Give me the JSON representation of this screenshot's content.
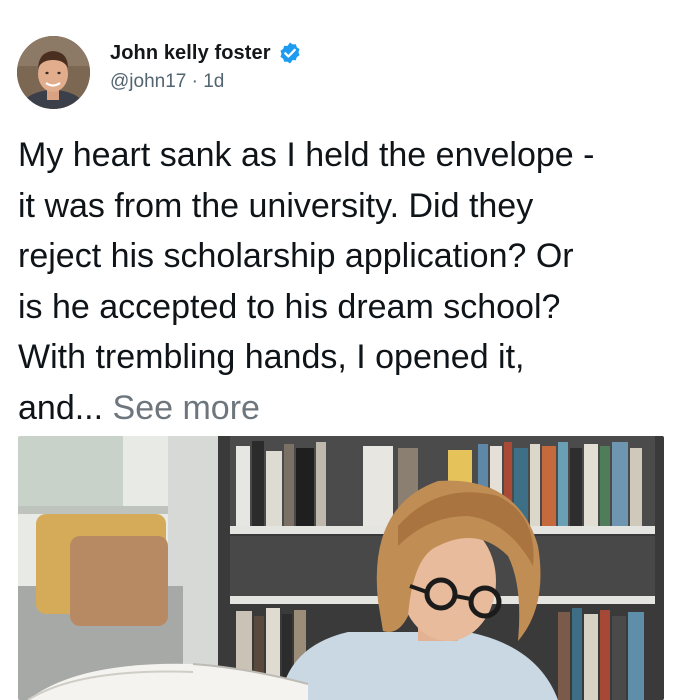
{
  "author": {
    "name": "John kelly foster",
    "handle": "@john17",
    "separator": "·",
    "time": "1d",
    "verified": true,
    "verified_color": "#1d9bf0"
  },
  "tweet": {
    "line1": "My heart sank as I held the envelope -",
    "line2": "it was from the university. Did they",
    "line3": "reject his scholarship application? Or",
    "line4": "is he accepted to his dream school?",
    "line5": "With trembling hands, I opened it,",
    "line6": "and...",
    "see_more": "See more"
  },
  "icons": {
    "avatar": "profile-photo",
    "verified": "verified-badge-icon"
  },
  "media": {
    "type": "photo"
  }
}
